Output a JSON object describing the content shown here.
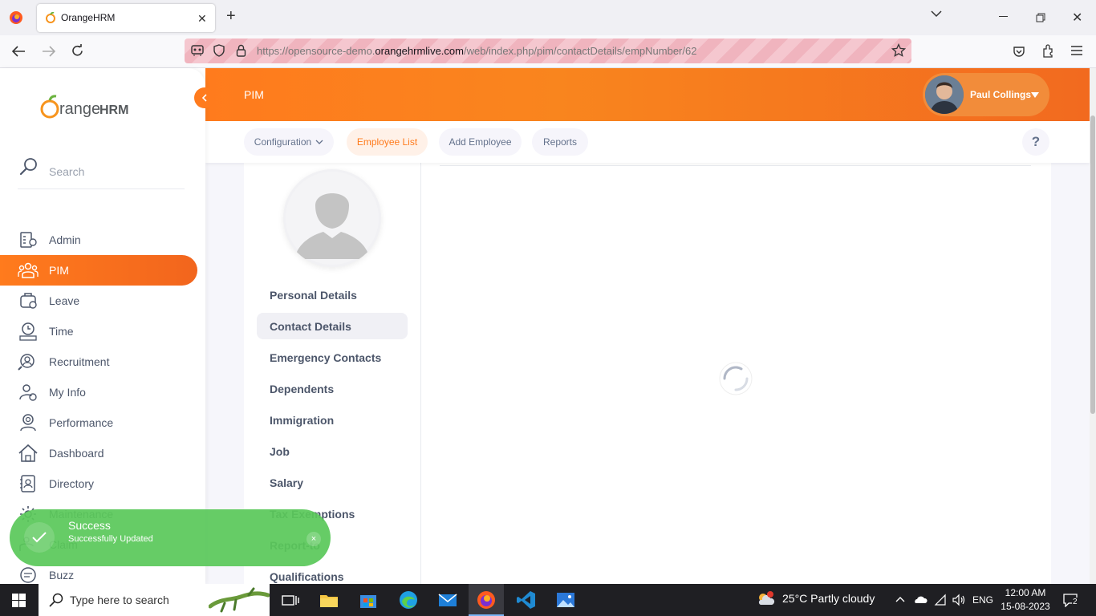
{
  "browser": {
    "tab_title": "OrangeHRM",
    "url_prefix": "https://opensource-demo.",
    "url_domain": "orangehrmlive.com",
    "url_path": "/web/index.php/pim/contactDetails/empNumber/62"
  },
  "header": {
    "module_title": "PIM",
    "user_name": "Paul Collings"
  },
  "subnav": {
    "configuration": "Configuration",
    "employee_list": "Employee List",
    "add_employee": "Add Employee",
    "reports": "Reports",
    "help": "?"
  },
  "sidebar": {
    "logo_text_1": "range",
    "logo_text_2": "HRM",
    "search_placeholder": "Search",
    "items": [
      {
        "label": "Admin",
        "icon": "admin-icon"
      },
      {
        "label": "PIM",
        "icon": "pim-icon",
        "active": true
      },
      {
        "label": "Leave",
        "icon": "leave-icon"
      },
      {
        "label": "Time",
        "icon": "time-icon"
      },
      {
        "label": "Recruitment",
        "icon": "recruitment-icon"
      },
      {
        "label": "My Info",
        "icon": "my-info-icon"
      },
      {
        "label": "Performance",
        "icon": "performance-icon"
      },
      {
        "label": "Dashboard",
        "icon": "dashboard-icon"
      },
      {
        "label": "Directory",
        "icon": "directory-icon"
      },
      {
        "label": "Maintenance",
        "icon": "maintenance-icon"
      },
      {
        "label": "Claim",
        "icon": "claim-icon"
      },
      {
        "label": "Buzz",
        "icon": "buzz-icon"
      }
    ]
  },
  "employee_tabs": [
    {
      "label": "Personal Details"
    },
    {
      "label": "Contact Details",
      "active": true
    },
    {
      "label": "Emergency Contacts"
    },
    {
      "label": "Dependents"
    },
    {
      "label": "Immigration"
    },
    {
      "label": "Job"
    },
    {
      "label": "Salary"
    },
    {
      "label": "Tax Exemptions"
    },
    {
      "label": "Report-to"
    },
    {
      "label": "Qualifications"
    }
  ],
  "toast": {
    "title": "Success",
    "message": "Successfully Updated",
    "close": "×"
  },
  "taskbar": {
    "search_placeholder": "Type here to search",
    "weather": "25°C  Partly cloudy",
    "language": "ENG",
    "time": "12:00 AM",
    "date": "15-08-2023",
    "notifications": "2"
  },
  "colors": {
    "accent": "#ff7b1d",
    "success": "#5ac85a",
    "text": "#4c566a"
  }
}
